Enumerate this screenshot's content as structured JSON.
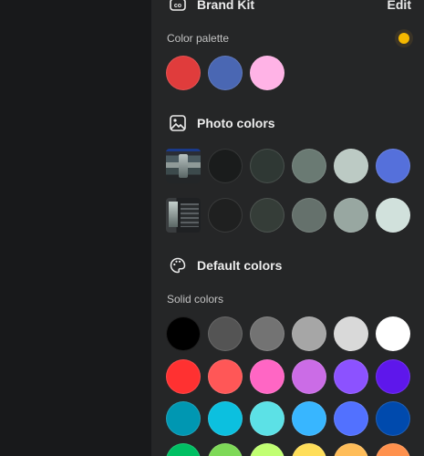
{
  "brand_kit": {
    "title": "Brand Kit",
    "edit_label": "Edit",
    "palette_label": "Color palette",
    "colors": [
      "#e03c3c",
      "#4a67b3",
      "#ffb3e6"
    ]
  },
  "photo_colors": {
    "title": "Photo colors",
    "rows": [
      {
        "swatches": [
          "#1a1c1c",
          "#2f3834",
          "#6a7a73",
          "#bccac4",
          "#5570db"
        ]
      },
      {
        "swatches": [
          "#1f2020",
          "#353d38",
          "#65716c",
          "#98a7a1",
          "#d1e1dc"
        ]
      }
    ]
  },
  "default_colors": {
    "title": "Default colors",
    "solid_label": "Solid colors",
    "rows": [
      [
        "#000000",
        "#545454",
        "#737373",
        "#a6a6a6",
        "#d9d9d9",
        "#ffffff"
      ],
      [
        "#ff3131",
        "#ff5757",
        "#ff66c4",
        "#cb6ce6",
        "#8c52ff",
        "#5e17eb"
      ],
      [
        "#0097b2",
        "#0cc0df",
        "#5ce1e6",
        "#38b6ff",
        "#5271ff",
        "#004aad"
      ],
      [
        "#00bf63",
        "#7ed957",
        "#c1ff72",
        "#ffde59",
        "#ffbd59",
        "#ff914d"
      ]
    ]
  }
}
